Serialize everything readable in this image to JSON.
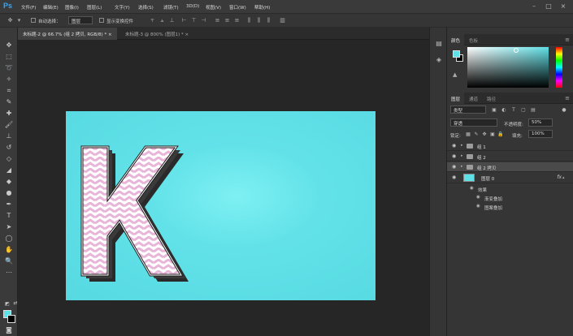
{
  "app": {
    "logo": "Ps"
  },
  "menu": [
    "文件(F)",
    "编辑(E)",
    "图像(I)",
    "图层(L)",
    "文字(Y)",
    "选择(S)",
    "滤镜(T)",
    "3D(D)",
    "视图(V)",
    "窗口(W)",
    "帮助(H)"
  ],
  "options": {
    "auto_select_label": "自动选择：",
    "auto_select_value": "图层",
    "show_transform_label": "显示变换控件"
  },
  "tabs": [
    {
      "label": "未标题-2 @ 66.7% (组 2 拷贝, RGB/8) *  ×"
    },
    {
      "label": "未标题-3 @ 800% (图层1) *  ×"
    }
  ],
  "color_panel": {
    "tabs": [
      "颜色",
      "色板"
    ],
    "fg_color": "#5ee0e6",
    "bg_color": "#000000"
  },
  "layers_panel": {
    "tabs": [
      "图层",
      "通道",
      "路径"
    ],
    "filter_kind": "类型",
    "blend_mode": "穿透",
    "opacity_label": "不透明度:",
    "opacity_value": "50%",
    "lock_label": "锁定:",
    "fill_label": "填充:",
    "fill_value": "100%",
    "layers": [
      {
        "name": "组 1",
        "type": "group"
      },
      {
        "name": "组 2",
        "type": "group"
      },
      {
        "name": "组 2 拷贝",
        "type": "group",
        "selected": true
      },
      {
        "name": "图层 0",
        "type": "layer",
        "fx": "fx"
      }
    ],
    "effects_label": "效果",
    "effects": [
      "渐变叠加",
      "图案叠加"
    ]
  },
  "canvas": {
    "letter": "K",
    "background": "#5ee0e6",
    "pattern_color": "#e8b4d8"
  }
}
